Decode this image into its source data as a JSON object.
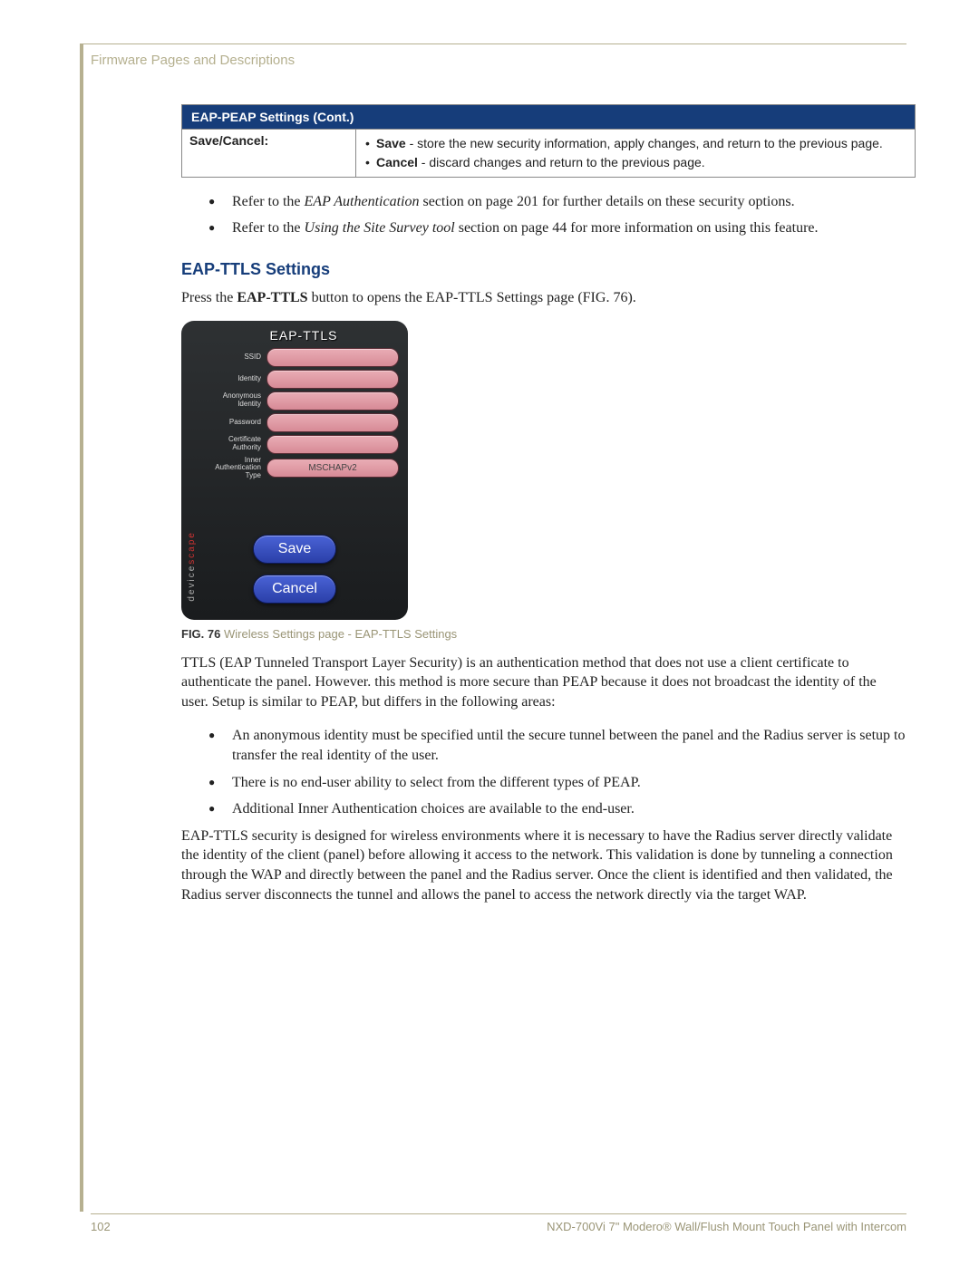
{
  "header": {
    "section_title": "Firmware Pages and Descriptions"
  },
  "table": {
    "title": "EAP-PEAP Settings (Cont.)",
    "row_label": "Save/Cancel:",
    "bullets": {
      "save_bold": "Save",
      "save_rest": " - store the new security information, apply changes, and return to the previous page.",
      "cancel_bold": "Cancel",
      "cancel_rest": " - discard changes and return to the previous page."
    }
  },
  "refs": {
    "a_pre": "Refer to the ",
    "a_italic": "EAP Authentication",
    "a_post": " section on page 201 for further details on these security options.",
    "b_pre": "Refer to the ",
    "b_italic": "Using the Site Survey tool",
    "b_post": " section on page 44 for more information on using this feature."
  },
  "section": {
    "heading": "EAP-TTLS Settings"
  },
  "intro": {
    "pre": "Press the ",
    "bold": "EAP-TTLS",
    "post": " button to opens the EAP-TTLS Settings page (FIG. 76)."
  },
  "panel": {
    "title": "EAP-TTLS",
    "labels": {
      "ssid": "SSID",
      "identity": "Identity",
      "anon": "Anonymous Identity",
      "password": "Password",
      "ca": "Certificate Authority",
      "inner": "Inner Authentication Type"
    },
    "inner_value": "MSCHAPv2",
    "save": "Save",
    "cancel": "Cancel",
    "brand_a": "device",
    "brand_b": "scape"
  },
  "figure": {
    "num": "FIG. 76",
    "caption": "  Wireless Settings page - EAP-TTLS Settings"
  },
  "para1": "TTLS (EAP Tunneled Transport Layer Security) is an authentication method that does not use a client certificate to authenticate the panel. However. this method is more secure than PEAP because it does not broadcast the identity of the user. Setup is similar to PEAP, but differs in the following areas:",
  "diffs": {
    "a": "An anonymous identity must be specified until the secure tunnel between the panel and the Radius server is setup to transfer the real identity of the user.",
    "b": "There is no end-user ability to select from the different types of PEAP.",
    "c": "Additional Inner Authentication choices are available to the end-user."
  },
  "para2": "EAP-TTLS security is designed for wireless environments where it is necessary to have the Radius server directly validate the identity of the client (panel) before allowing it access to the network. This validation is done by tunneling a connection through the WAP and directly between the panel and the Radius server. Once the client is identified and then validated, the Radius server disconnects the tunnel and allows the panel to access the network directly via the target WAP.",
  "footer": {
    "page_num": "102",
    "product": "NXD-700Vi 7\" Modero® Wall/Flush Mount Touch Panel with Intercom"
  }
}
